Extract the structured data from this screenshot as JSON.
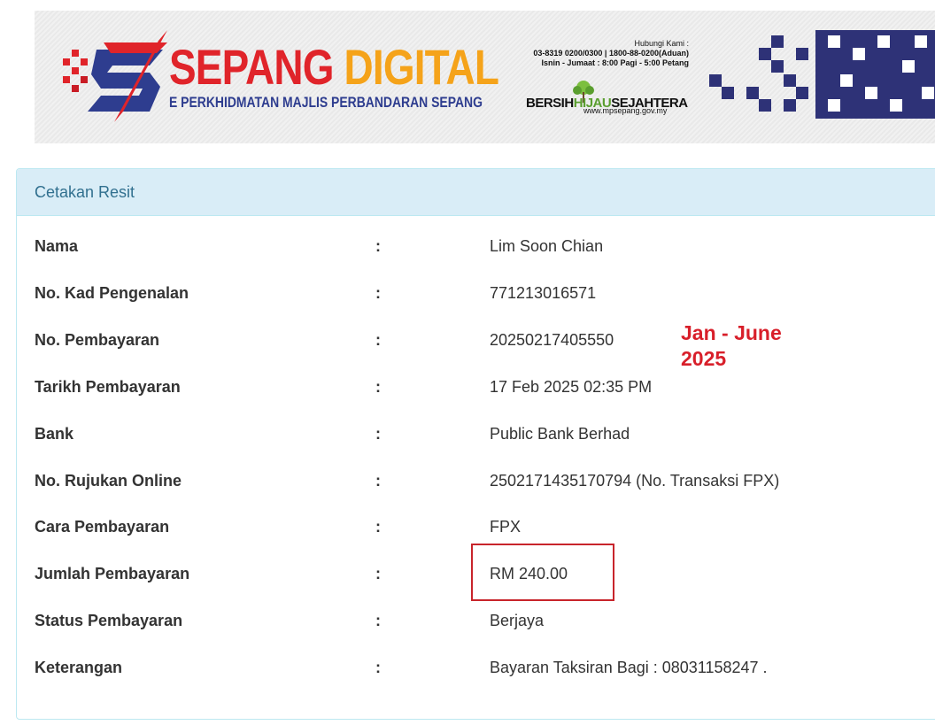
{
  "banner": {
    "brand_left": "SEPANG ",
    "brand_right": "DIGITAL",
    "subtitle": "E PERKHIDMATAN MAJLIS PERBANDARAN SEPANG",
    "contact_title": "Hubungi Kami :",
    "contact_phone": "03-8319 0200/0300 | 1800-88-0200(Aduan)",
    "contact_hours": "Isnin - Jumaat : 8:00 Pagi - 5:00 Petang",
    "slogan_a": "BERSIH",
    "slogan_b": "HIJAU",
    "slogan_c": "SEJAHTERA",
    "website": "www.mpsepang.gov.my",
    "colors": {
      "red": "#e0242a",
      "orange": "#f5a31a",
      "navy": "#2e3d8f",
      "green": "#5a9e2f"
    }
  },
  "panel": {
    "heading": "Cetakan Resit",
    "colon": ":",
    "rows": [
      {
        "label": "Nama",
        "value": "Lim Soon Chian"
      },
      {
        "label": "No. Kad Pengenalan",
        "value": "771213016571"
      },
      {
        "label": "No. Pembayaran",
        "value": "20250217405550"
      },
      {
        "label": "Tarikh Pembayaran",
        "value": "17 Feb 2025 02:35 PM"
      },
      {
        "label": "Bank",
        "value": "Public Bank Berhad"
      },
      {
        "label": "No. Rujukan Online",
        "value": "2502171435170794 (No. Transaksi FPX)"
      },
      {
        "label": "Cara Pembayaran",
        "value": "FPX"
      },
      {
        "label": "Jumlah Pembayaran",
        "value": "RM 240.00"
      },
      {
        "label": "Status Pembayaran",
        "value": "Berjaya"
      },
      {
        "label": "Keterangan",
        "value": "Bayaran Taksiran Bagi : 08031158247 ."
      }
    ]
  },
  "annotation": {
    "line1": "Jan - June",
    "line2": "2025",
    "color": "#d81f2a"
  }
}
